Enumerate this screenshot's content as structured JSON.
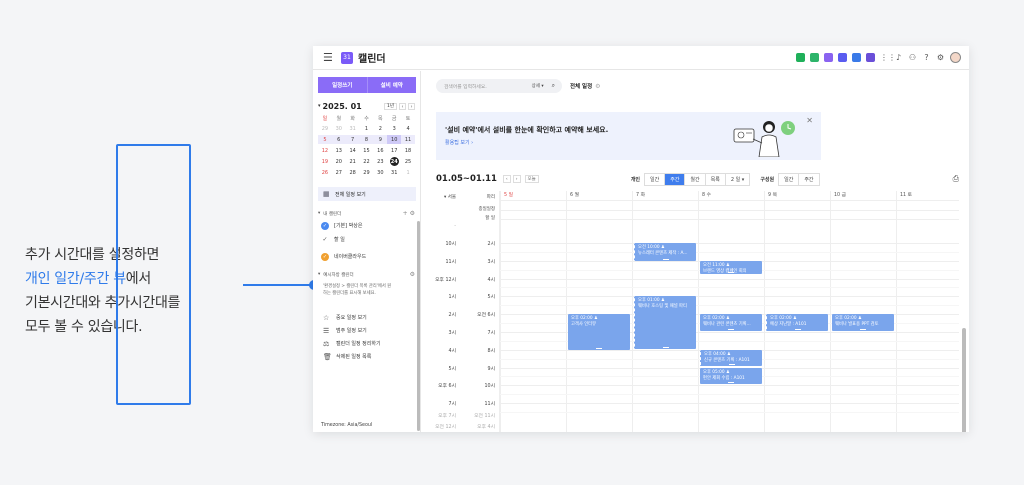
{
  "caption": {
    "line1": "추가 시간대를 설정하면",
    "line2_highlight": "개인 일간/주간 뷰",
    "line2_rest": "에서",
    "line3": "기본시간대와 추가시간대를",
    "line4": "모두 볼 수 있습니다."
  },
  "topbar": {
    "app_icon_text": "31",
    "title": "캘린더",
    "icons": [
      {
        "name": "messenger-icon",
        "color": "#1fb05a"
      },
      {
        "name": "mail-icon",
        "color": "#2db46a"
      },
      {
        "name": "board-icon",
        "color": "#8a63f0"
      },
      {
        "name": "approval-icon",
        "color": "#5a5cf0"
      },
      {
        "name": "drive-icon",
        "color": "#3a7ae8"
      },
      {
        "name": "circle-app-icon",
        "color": "#6a4fd8"
      }
    ]
  },
  "sidebar": {
    "btn_schedule": "일정쓰기",
    "btn_facility": "설비 예약",
    "month": "2025. 01",
    "today_btn": "1년",
    "weekdays": [
      "일",
      "월",
      "화",
      "수",
      "목",
      "금",
      "토"
    ],
    "weeks": [
      [
        "29",
        "30",
        "31",
        "1",
        "2",
        "3",
        "4"
      ],
      [
        "5",
        "6",
        "7",
        "8",
        "9",
        "10",
        "11"
      ],
      [
        "12",
        "13",
        "14",
        "15",
        "16",
        "17",
        "18"
      ],
      [
        "19",
        "20",
        "21",
        "22",
        "23",
        "24",
        "25"
      ],
      [
        "26",
        "27",
        "28",
        "29",
        "30",
        "31",
        "1"
      ]
    ],
    "all_schedule": "전체 일정 보기",
    "my_calendar": "내 캘린더",
    "cal_items": [
      {
        "label": "[기본] 박상은",
        "color": "#4a8af0",
        "type": "fill"
      },
      {
        "label": "할 일",
        "color": "#555",
        "type": "check"
      },
      {
        "label": "네이버클라우드",
        "color": "#f0a030",
        "type": "fill"
      }
    ],
    "shared_calendar": "예시자방 캘린더",
    "note_line1": "'환경설정 > 캘린더 목록 관리'에서 원",
    "note_line2": "하는 캘린더를 표시해 보세요.",
    "menu": [
      {
        "label": "중요 일정 보기",
        "icon": "☆"
      },
      {
        "label": "범주 일정 보기",
        "icon": "☰"
      },
      {
        "label": "캘린더 일정 정리하기",
        "icon": "⚖"
      },
      {
        "label": "삭제된 일정 목록",
        "icon": "🗑"
      }
    ],
    "timezone": "Timezone: Asia/Seoul"
  },
  "search": {
    "placeholder": "검색어를 입력하세요.",
    "scope": "상세 ▾",
    "title": "전체 일정"
  },
  "banner": {
    "title": "'설비 예약'에서 설비를 한눈에 확인하고 예약해 보세요.",
    "link": "활용팁 보기 ›"
  },
  "toolbar": {
    "range": "01.05~01.11",
    "today": "오늘",
    "personal": "개인",
    "views_personal": [
      "일간",
      "주간",
      "월간",
      "목록",
      "2 일 ▾"
    ],
    "active_view": "주간",
    "member": "구성원",
    "views_member": [
      "일간",
      "주간"
    ]
  },
  "grid": {
    "tz_primary": "▾ 서울",
    "tz_secondary": "파리",
    "allday_label": "종일일정",
    "todo_label": "할 일",
    "days": [
      "5 일",
      "6 월",
      "7 화",
      "8 수",
      "9 목",
      "10 금",
      "11 토"
    ],
    "primary_times": [
      "10시",
      "11시",
      "오후 12시",
      "1시",
      "2시",
      "3시",
      "4시",
      "5시",
      "오후 6시",
      "7시"
    ],
    "secondary_times": [
      "2시",
      "3시",
      "4시",
      "5시",
      "오전 6시",
      "7시",
      "8시",
      "9시",
      "10시",
      "11시"
    ],
    "extra_primary": [
      "오후 7시",
      "오전 12시"
    ],
    "extra_secondary": [
      "오전 11시",
      "오후 4시"
    ],
    "events": [
      {
        "day": 2,
        "start": 10.0,
        "dur": 1.1,
        "title": "오전 10:00",
        "desc": "뉴스레터 콘텐츠 제작 : A...",
        "dash": true
      },
      {
        "day": 3,
        "start": 11.0,
        "dur": 0.8,
        "title": "오전 11:00",
        "desc": "브랜드 영상 캠페인 회의",
        "dash": false
      },
      {
        "day": 1,
        "start": 14.0,
        "dur": 2.1,
        "title": "오후 02:00",
        "desc": "고객사 인터뷰",
        "dash": false
      },
      {
        "day": 2,
        "start": 13.0,
        "dur": 3.0,
        "title": "오후 01:00",
        "desc": "웨비나 호스팅 및 패널 파티",
        "dash": true
      },
      {
        "day": 3,
        "start": 14.0,
        "dur": 1.0,
        "title": "오후 02:00",
        "desc": "웨비나 관련 콘텐츠 기획...",
        "dash": false
      },
      {
        "day": 4,
        "start": 14.0,
        "dur": 1.0,
        "title": "오후 02:00",
        "desc": "예상 지난말 : A101",
        "dash": true
      },
      {
        "day": 5,
        "start": 14.0,
        "dur": 1.0,
        "title": "오후 02:00",
        "desc": "웨비나 발표용 PPT 검토",
        "dash": false
      },
      {
        "day": 3,
        "start": 16.0,
        "dur": 1.0,
        "title": "오후 04:00",
        "desc": "신규 콘텐츠 기획 : A101",
        "dash": true
      },
      {
        "day": 3,
        "start": 17.0,
        "dur": 1.0,
        "title": "오후 05:00",
        "desc": "편안 제회 수립 : A101",
        "dash": false
      }
    ]
  }
}
